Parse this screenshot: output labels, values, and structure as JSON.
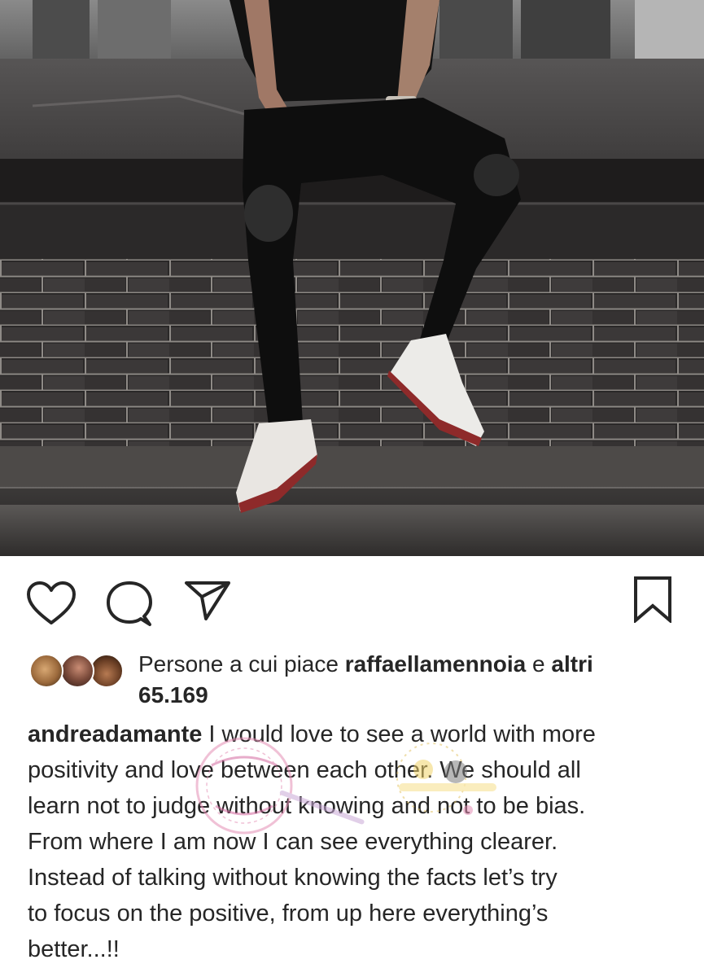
{
  "post": {
    "likes": {
      "prefix": "Persone a cui piace ",
      "user": "raffaellamennoia",
      "joiner": " e ",
      "others_label": "altri",
      "others_count": "65.169"
    },
    "caption": {
      "username": "andreadamante",
      "lines": [
        " I would love to see a world with more",
        "positivity and love between each other. We should all",
        "learn not to judge without knowing and not to be bias.",
        "From where I am now I can see everything clearer.",
        "Instead of talking without knowing the facts let’s try",
        "to focus on the positive, from up here everything’s",
        "better...!!"
      ]
    }
  },
  "icons": {
    "like": "heart-icon",
    "comment": "comment-icon",
    "share": "paper-plane-icon",
    "save": "bookmark-icon"
  },
  "colors": {
    "text": "#262626",
    "background": "#ffffff"
  }
}
